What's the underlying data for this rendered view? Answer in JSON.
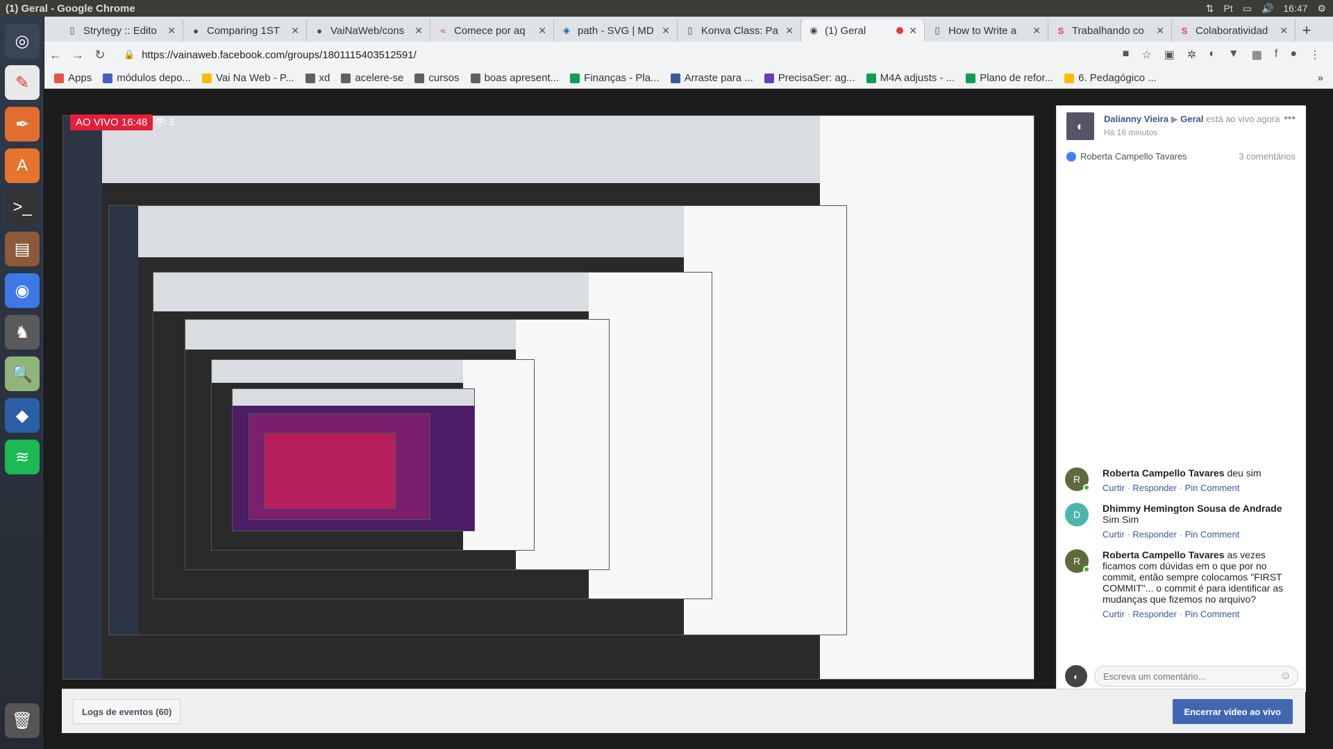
{
  "os": {
    "window_title": "(1) Geral - Google Chrome",
    "clock": "16:47",
    "lang_indicator": "Pt"
  },
  "launcher": {
    "items": [
      "ubuntu-dash",
      "vectr",
      "inkscape",
      "software-center",
      "terminal",
      "files",
      "chrome",
      "gimp",
      "image-viewer",
      "vscode",
      "spotify",
      "trash"
    ]
  },
  "browser": {
    "tabs": [
      {
        "label": "Strytegy :: Edito",
        "icon": "page-icon"
      },
      {
        "label": "Comparing 1ST",
        "icon": "github-icon"
      },
      {
        "label": "VaiNaWeb/cons",
        "icon": "github-icon"
      },
      {
        "label": "Comece por aq",
        "icon": "mustache-icon"
      },
      {
        "label": "path - SVG | MD",
        "icon": "mdn-icon"
      },
      {
        "label": "Konva Class: Pa",
        "icon": "page-icon"
      },
      {
        "label": "(1) Geral",
        "icon": "facebook-live-icon",
        "active": true,
        "recording": true
      },
      {
        "label": "How to Write a",
        "icon": "page-icon"
      },
      {
        "label": "Trabalhando co",
        "icon": "s-icon"
      },
      {
        "label": "Colaboratividad",
        "icon": "s-icon"
      }
    ],
    "url": "https://vainaweb.facebook.com/groups/1801115403512591/",
    "bookmarks": [
      {
        "label": "Apps",
        "color": "#e5554a"
      },
      {
        "label": "módulos depo...",
        "color": "#4a5fc1"
      },
      {
        "label": "Vai Na Web - P...",
        "color": "#fbbc05"
      },
      {
        "label": "xd",
        "color": "#616161"
      },
      {
        "label": "acelere-se",
        "color": "#616161"
      },
      {
        "label": "cursos",
        "color": "#616161"
      },
      {
        "label": "boas apresent...",
        "color": "#616161"
      },
      {
        "label": "Finanças - Pla...",
        "color": "#0f9d58"
      },
      {
        "label": "Arraste para ...",
        "color": "#3b5998"
      },
      {
        "label": "PrecisaSer: ag...",
        "color": "#6a3fb5"
      },
      {
        "label": "M4A adjusts - ...",
        "color": "#0f9d58"
      },
      {
        "label": "Plano de refor...",
        "color": "#0f9d58"
      },
      {
        "label": "6. Pedagógico ...",
        "color": "#fbbc05"
      }
    ]
  },
  "live": {
    "badge": "AO VIVO 16:48",
    "viewers": "5"
  },
  "post": {
    "author": "Dalianny Vieira",
    "arrow": "▶",
    "group": "Geral",
    "status": "está ao vivo agora",
    "time": "Há 16 minutos",
    "reactor": "Roberta Campello Tavares",
    "comment_count": "3 comentários"
  },
  "comments": [
    {
      "author": "Roberta Campello Tavares",
      "text": "deu sim",
      "avatar": "R",
      "online": true
    },
    {
      "author": "Dhimmy Hemington Sousa de Andrade",
      "text": "Sim Sim",
      "avatar": "D",
      "online": false
    },
    {
      "author": "Roberta Campello Tavares",
      "text": "as vezes ficamos com dúvidas em o que por no commit, então sempre colocamos \"FIRST COMMIT\"... o commit é para identificar as mudanças que fizemos no arquivo?",
      "avatar": "R",
      "online": true
    }
  ],
  "comment_actions": {
    "like": "Curtir",
    "reply": "Responder",
    "pin": "Pin Comment",
    "sep": "·"
  },
  "composer": {
    "placeholder": "Escreva um comentário..."
  },
  "footer": {
    "logs": "Logs de eventos (60)",
    "end_live": "Encerrar vídeo ao vivo"
  }
}
